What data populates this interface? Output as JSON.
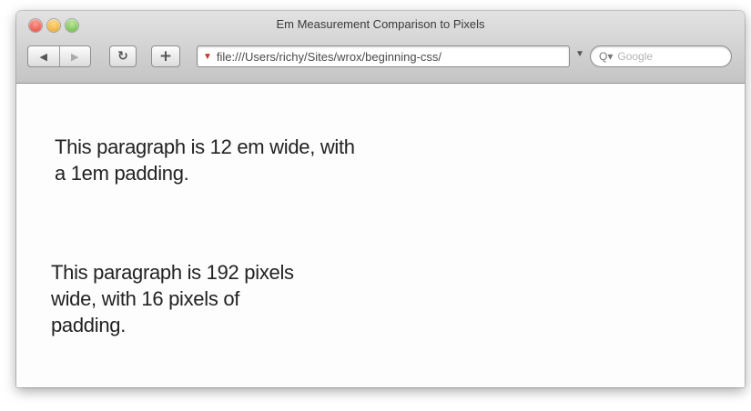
{
  "window": {
    "title": "Em Measurement Comparison to Pixels"
  },
  "toolbar": {
    "back_glyph": "◀",
    "forward_glyph": "▶",
    "reload_glyph": "↻",
    "add_bookmark_glyph": "+"
  },
  "address_bar": {
    "url": "file:///Users/richy/Sites/wrox/beginning-css/"
  },
  "search": {
    "placeholder": "Google"
  },
  "content": {
    "paragraphs": [
      {
        "text": "This paragraph is 12 em wide, with a 1em padding."
      },
      {
        "text": "This paragraph is 192 pixels wide, with 16 pixels of padding."
      }
    ]
  },
  "icons": {
    "close": "close-icon",
    "minimize": "minimize-icon",
    "zoom": "zoom-icon",
    "back": "back-arrow-icon",
    "forward": "forward-arrow-icon",
    "reload": "reload-icon",
    "add_bookmark": "add-bookmark-icon",
    "favicon": "favicon-icon",
    "search": "search-icon"
  },
  "colors": {
    "close": "#e0443a",
    "minimize": "#e6a21e",
    "zoom": "#5fb23d"
  }
}
